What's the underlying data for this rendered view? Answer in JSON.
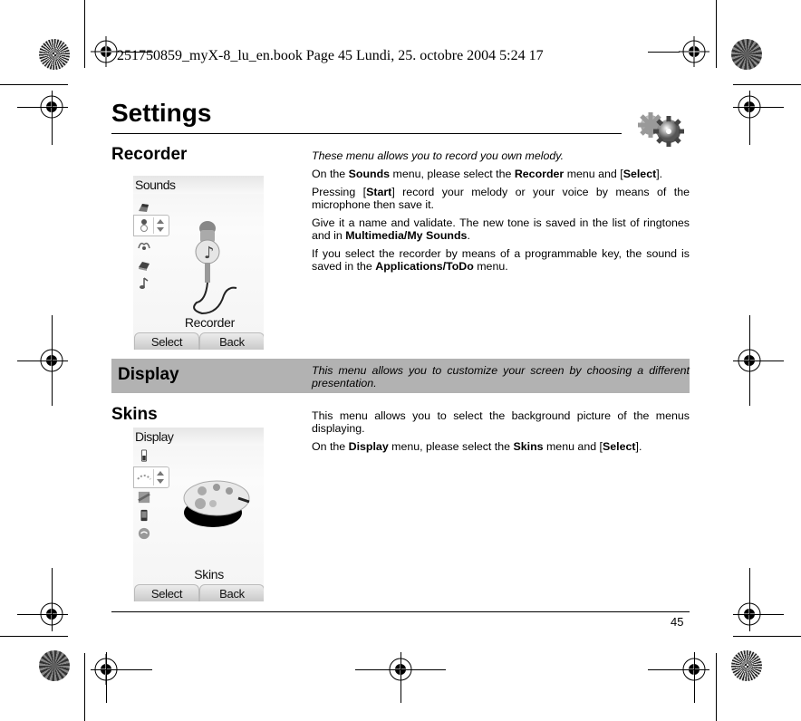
{
  "print_header": "251750859_myX-8_lu_en.book  Page 45  Lundi, 25. octobre 2004  5:24 17",
  "page": {
    "title": "Settings",
    "title_icon": "gears-icon",
    "page_number": "45"
  },
  "sections": {
    "recorder": {
      "title": "Recorder",
      "paragraphs": [
        {
          "style": "italic",
          "parts": [
            {
              "t": "These menu allows you to record you own melody."
            }
          ]
        },
        {
          "parts": [
            {
              "t": "On the "
            },
            {
              "t": "Sounds",
              "b": true
            },
            {
              "t": " menu, please select the "
            },
            {
              "t": "Recorder",
              "b": true
            },
            {
              "t": " menu and ["
            },
            {
              "t": "Select",
              "b": true
            },
            {
              "t": "]."
            }
          ]
        },
        {
          "parts": [
            {
              "t": "Pressing ["
            },
            {
              "t": "Start",
              "b": true
            },
            {
              "t": "] record your melody or your voice by means of the microphone then save it."
            }
          ]
        },
        {
          "parts": [
            {
              "t": "Give it a name and validate. The new tone is saved in the list of ringtones and in "
            },
            {
              "t": "Multimedia/My Sounds",
              "b": true
            },
            {
              "t": "."
            }
          ]
        },
        {
          "parts": [
            {
              "t": "If you select the recorder by means of a programmable key, the sound is saved in the "
            },
            {
              "t": "Applications/ToDo",
              "b": true
            },
            {
              "t": " menu."
            }
          ]
        }
      ],
      "phone_screen": {
        "title": "Sounds",
        "label": "Recorder",
        "softkey_left": "Select",
        "softkey_right": "Back",
        "icons": [
          "ringtone-icon",
          "recorder-icon",
          "volume-icon",
          "keypad-tones-icon",
          "melody-icon"
        ],
        "illustration": "microphone-icon"
      }
    },
    "display": {
      "title": "Display",
      "description": "This menu allows you to customize your screen by choosing a different presentation."
    },
    "skins": {
      "title": "Skins",
      "paragraphs": [
        {
          "parts": [
            {
              "t": "This menu allows you to select the background picture of the menus displaying."
            }
          ]
        },
        {
          "parts": [
            {
              "t": "On the "
            },
            {
              "t": "Display",
              "b": true
            },
            {
              "t": " menu, please select the "
            },
            {
              "t": "Skins",
              "b": true
            },
            {
              "t": " menu and ["
            },
            {
              "t": "Select",
              "b": true
            },
            {
              "t": "]."
            }
          ]
        }
      ],
      "phone_screen": {
        "title": "Display",
        "label": "Skins",
        "softkey_left": "Select",
        "softkey_right": "Back",
        "icons": [
          "battery-icon",
          "skins-icon",
          "wallpaper-icon",
          "screensaver-icon",
          "greeting-icon"
        ],
        "illustration": "palette-icon"
      }
    }
  },
  "colors": {
    "banner": "#b2b2b2",
    "text": "#000000"
  }
}
